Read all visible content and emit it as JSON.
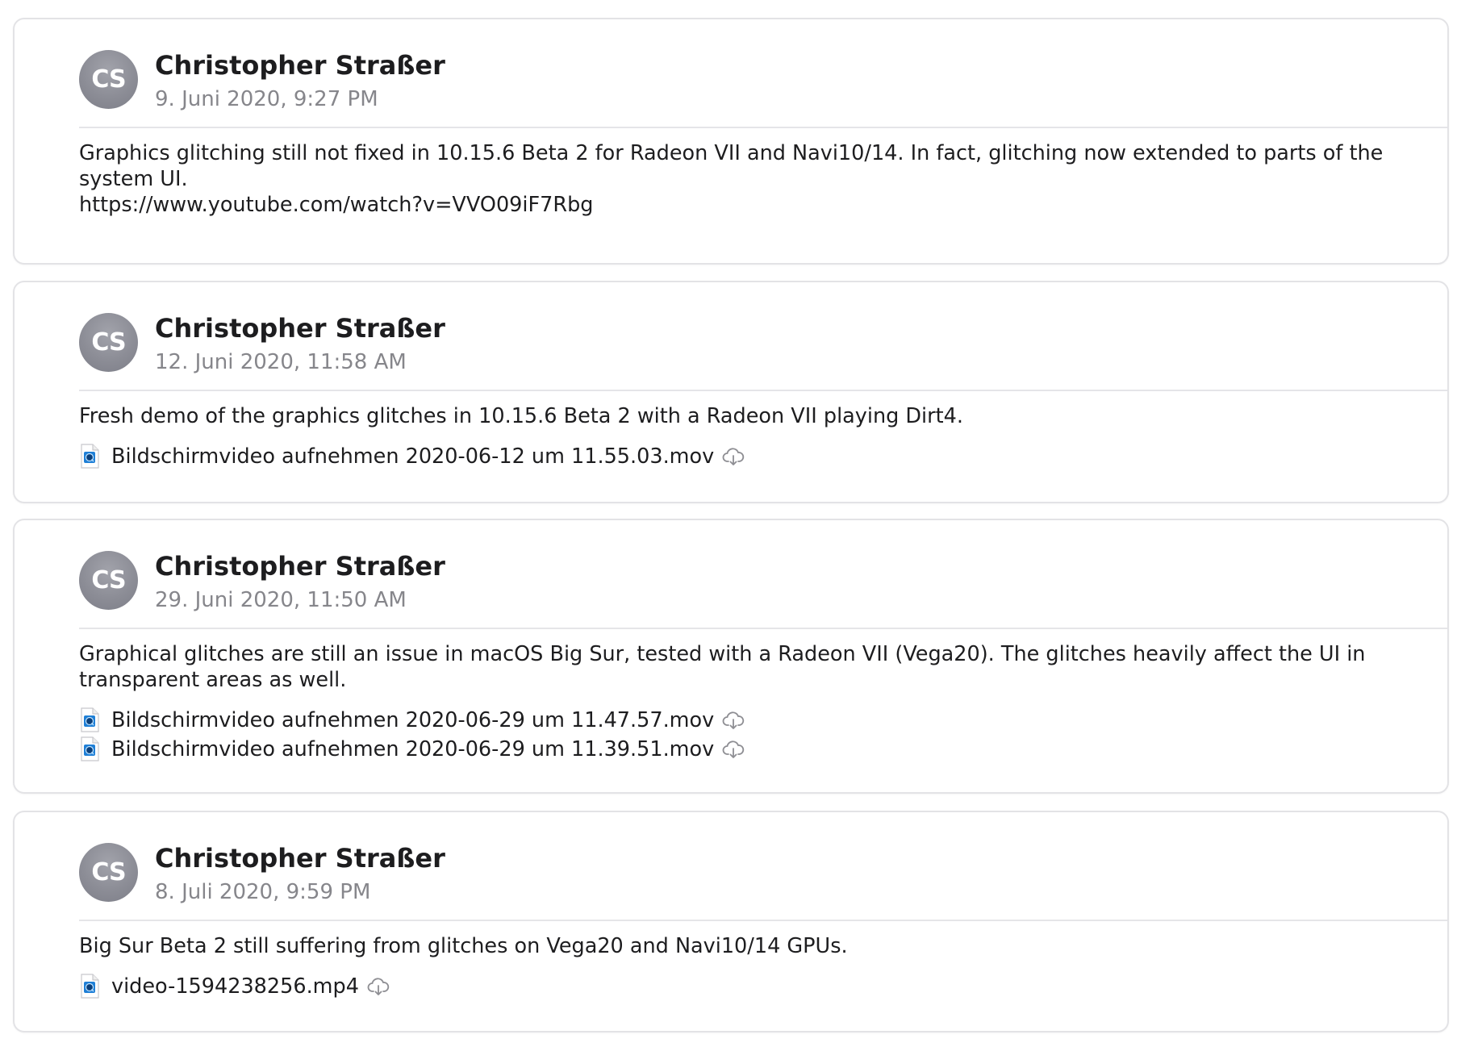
{
  "posts": [
    {
      "avatar_initials": "CS",
      "author": "Christopher Straßer",
      "date": "9. Juni 2020, 9:27 PM",
      "body_lines": [
        "Graphics glitching still not fixed in 10.15.6 Beta 2 for Radeon VII and Navi10/14. In fact, glitching now extended to parts of the",
        "system UI.",
        "https://www.youtube.com/watch?v=VVO09iF7Rbg"
      ],
      "attachments": []
    },
    {
      "avatar_initials": "CS",
      "author": "Christopher Straßer",
      "date": "12. Juni 2020, 11:58 AM",
      "body_lines": [
        "Fresh demo of the graphics glitches in 10.15.6 Beta 2 with a Radeon VII playing Dirt4."
      ],
      "attachments": [
        {
          "name": "Bildschirmvideo aufnehmen 2020-06-12 um 11.55.03.mov",
          "icon": "quicktime-file-icon",
          "action_icon": "cloud-download-icon"
        }
      ]
    },
    {
      "avatar_initials": "CS",
      "author": "Christopher Straßer",
      "date": "29. Juni 2020, 11:50 AM",
      "body_lines": [
        "Graphical glitches are still an issue in macOS Big Sur, tested with a Radeon VII (Vega20). The glitches heavily affect the UI in",
        "transparent areas as well."
      ],
      "attachments": [
        {
          "name": "Bildschirmvideo aufnehmen 2020-06-29 um 11.47.57.mov",
          "icon": "quicktime-file-icon",
          "action_icon": "cloud-download-icon"
        },
        {
          "name": "Bildschirmvideo aufnehmen 2020-06-29 um 11.39.51.mov",
          "icon": "quicktime-file-icon",
          "action_icon": "cloud-download-icon"
        }
      ]
    },
    {
      "avatar_initials": "CS",
      "author": "Christopher Straßer",
      "date": "8. Juli 2020, 9:59 PM",
      "body_lines": [
        "Big Sur Beta 2 still suffering from glitches on Vega20 and Navi10/14 GPUs."
      ],
      "attachments": [
        {
          "name": "video-1594238256.mp4",
          "icon": "quicktime-file-icon",
          "action_icon": "cloud-download-icon"
        }
      ]
    }
  ],
  "colors": {
    "avatar_bg": "#8c8d96",
    "author_text": "#1d1d1f",
    "date_text": "#86868b",
    "card_border": "#e3e3e6"
  }
}
